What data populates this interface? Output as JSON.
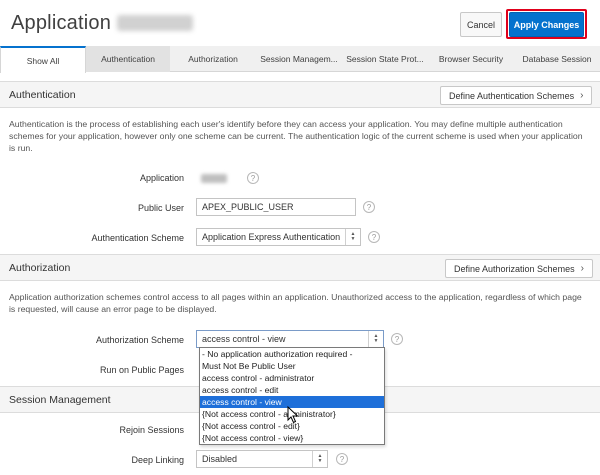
{
  "header": {
    "title": "Application",
    "cancel_label": "Cancel",
    "apply_label": "Apply Changes"
  },
  "tabs": [
    {
      "label": "Show All"
    },
    {
      "label": "Authentication"
    },
    {
      "label": "Authorization"
    },
    {
      "label": "Session Managem..."
    },
    {
      "label": "Session State Prot..."
    },
    {
      "label": "Browser Security"
    },
    {
      "label": "Database Session"
    }
  ],
  "authentication": {
    "title": "Authentication",
    "define_button": "Define Authentication Schemes",
    "description": "Authentication is the process of establishing each user's identify before they can access your application. You may define multiple authentication schemes for your application, however only one scheme can be current. The authentication logic of the current scheme is used when your application is run.",
    "application_label": "Application",
    "public_user_label": "Public User",
    "public_user_value": "APEX_PUBLIC_USER",
    "scheme_label": "Authentication Scheme",
    "scheme_value": "Application Express Authentication"
  },
  "authorization": {
    "title": "Authorization",
    "define_button": "Define Authorization Schemes",
    "description": "Application authorization schemes control access to all pages within an application. Unauthorized access to the application, regardless of which page is requested, will cause an error page to be displayed.",
    "scheme_label": "Authorization Scheme",
    "scheme_value": "access control - view",
    "run_public_label": "Run on Public Pages",
    "options": [
      "- No application authorization required -",
      "Must Not Be Public User",
      "access control - administrator",
      "access control - edit",
      "access control - view",
      "{Not access control - administrator}",
      "{Not access control - edit}",
      "{Not access control - view}"
    ]
  },
  "session_management": {
    "title": "Session Management",
    "rejoin_label": "Rejoin Sessions",
    "deep_linking_label": "Deep Linking",
    "deep_linking_value": "Disabled"
  },
  "icons": {
    "help": "?",
    "chevron": "›"
  }
}
